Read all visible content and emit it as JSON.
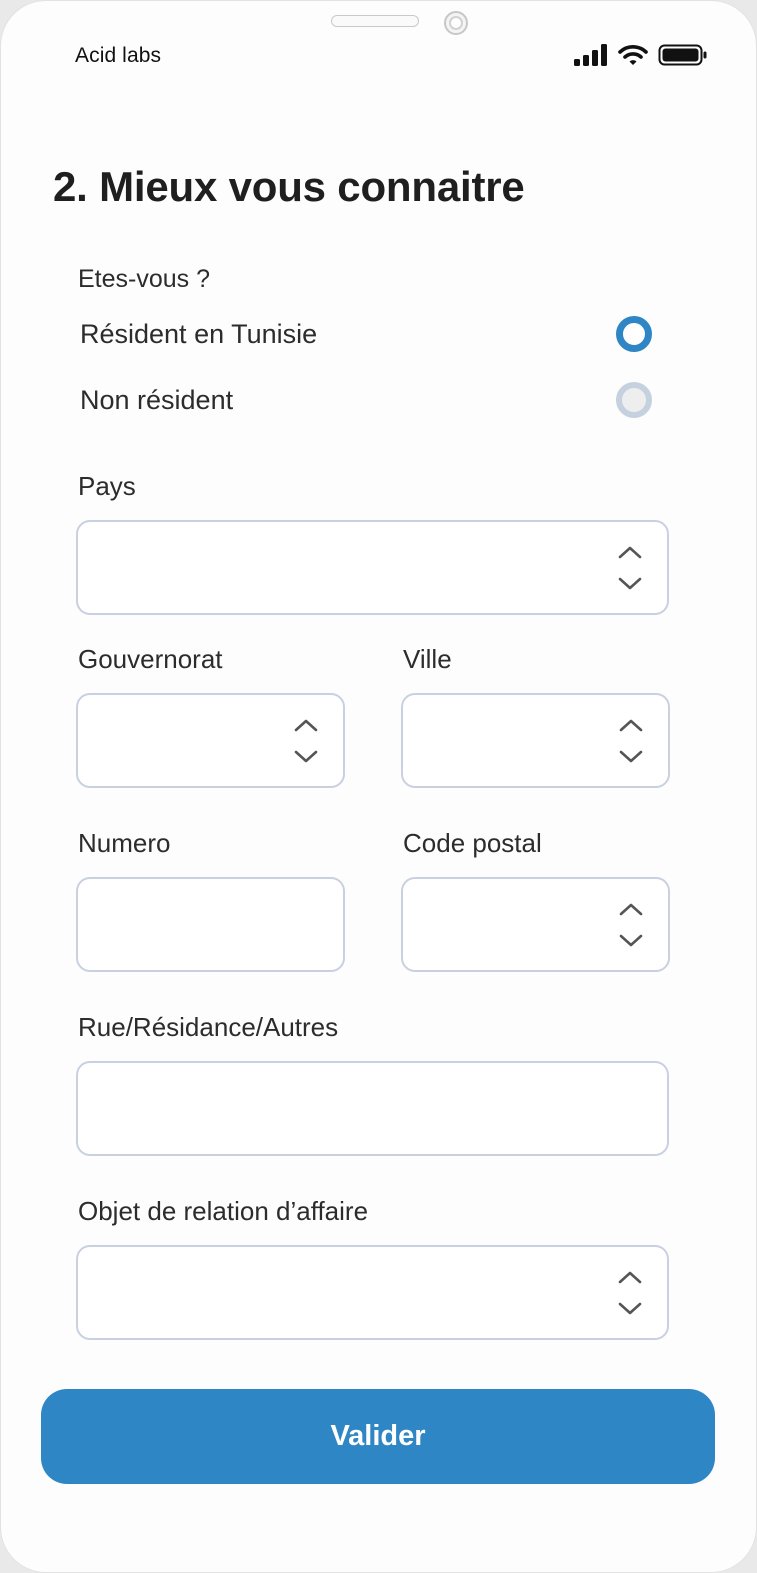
{
  "status_bar": {
    "carrier": "Acid labs",
    "icons": [
      "signal-icon",
      "wifi-icon",
      "battery-icon"
    ]
  },
  "form": {
    "title": "2. Mieux vous connaitre",
    "residency": {
      "question": "Etes-vous ?",
      "options": [
        {
          "label": "Résident en Tunisie",
          "selected": true
        },
        {
          "label": "Non résident",
          "selected": false
        }
      ]
    },
    "fields": {
      "pays": {
        "label": "Pays",
        "value": ""
      },
      "gouvernorat": {
        "label": "Gouvernorat",
        "value": ""
      },
      "ville": {
        "label": "Ville",
        "value": ""
      },
      "numero": {
        "label": "Numero",
        "value": ""
      },
      "code_postal": {
        "label": "Code postal",
        "value": ""
      },
      "rue": {
        "label": "Rue/Résidance/Autres",
        "value": ""
      },
      "objet": {
        "label": "Objet de relation d’affaire",
        "value": ""
      }
    },
    "submit_label": "Valider"
  },
  "colors": {
    "accent": "#2f86c5",
    "field_border": "#c8d0e1",
    "radio_unchecked": "#c5d1df"
  }
}
